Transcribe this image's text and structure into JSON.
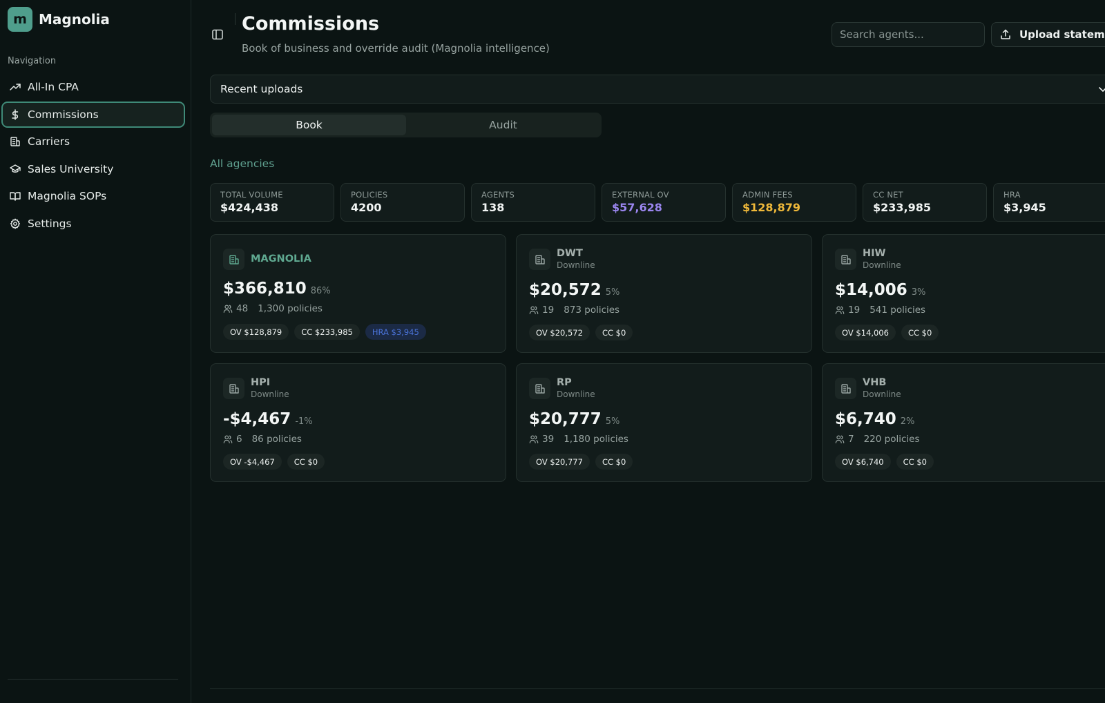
{
  "app": {
    "logo_letter": "m",
    "name": "Magnolia"
  },
  "sidebar": {
    "heading": "Navigation",
    "items": [
      {
        "label": "All-In CPA",
        "icon": "trending-up-icon",
        "active": false
      },
      {
        "label": "Commissions",
        "icon": "dollar-icon",
        "active": true
      },
      {
        "label": "Carriers",
        "icon": "building-icon",
        "active": false
      },
      {
        "label": "Sales University",
        "icon": "graduation-cap-icon",
        "active": false
      },
      {
        "label": "Magnolia SOPs",
        "icon": "book-icon",
        "active": false
      },
      {
        "label": "Settings",
        "icon": "gear-icon",
        "active": false
      }
    ]
  },
  "header": {
    "title": "Commissions",
    "subtitle": "Book of business and override audit (Magnolia intelligence)",
    "search_placeholder": "Search agents...",
    "upload_label": "Upload statement"
  },
  "recent": {
    "label": "Recent uploads"
  },
  "tabs": [
    {
      "label": "Book",
      "active": true
    },
    {
      "label": "Audit",
      "active": false
    }
  ],
  "section_label": "All agencies",
  "stats": [
    {
      "label": "TOTAL VOLUME",
      "value": "$424,438",
      "color": "#f1f4f3"
    },
    {
      "label": "POLICIES",
      "value": "4200",
      "color": "#f1f4f3"
    },
    {
      "label": "AGENTS",
      "value": "138",
      "color": "#f1f4f3"
    },
    {
      "label": "EXTERNAL OV",
      "value": "$57,628",
      "color": "#9b86f0"
    },
    {
      "label": "ADMIN FEES",
      "value": "$128,879",
      "color": "#f0b93a"
    },
    {
      "label": "CC NET",
      "value": "$233,985",
      "color": "#f1f4f3"
    },
    {
      "label": "HRA",
      "value": "$3,945",
      "color": "#f1f4f3"
    }
  ],
  "agencies": [
    {
      "name": "MAGNOLIA",
      "role": "",
      "amount": "$366,810",
      "pct": "86%",
      "agents": "48",
      "policies": "1,300 policies",
      "chips": [
        "OV $128,879",
        "CC $233,985",
        "HRA $3,945"
      ]
    },
    {
      "name": "DWT",
      "role": "Downline",
      "amount": "$20,572",
      "pct": "5%",
      "agents": "19",
      "policies": "873 policies",
      "chips": [
        "OV $20,572",
        "CC $0"
      ]
    },
    {
      "name": "HIW",
      "role": "Downline",
      "amount": "$14,006",
      "pct": "3%",
      "agents": "19",
      "policies": "541 policies",
      "chips": [
        "OV $14,006",
        "CC $0"
      ]
    },
    {
      "name": "HPI",
      "role": "Downline",
      "amount": "-$4,467",
      "pct": "-1%",
      "agents": "6",
      "policies": "86 policies",
      "chips": [
        "OV -$4,467",
        "CC $0"
      ]
    },
    {
      "name": "RP",
      "role": "Downline",
      "amount": "$20,777",
      "pct": "5%",
      "agents": "39",
      "policies": "1,180 policies",
      "chips": [
        "OV $20,777",
        "CC $0"
      ]
    },
    {
      "name": "VHB",
      "role": "Downline",
      "amount": "$6,740",
      "pct": "2%",
      "agents": "7",
      "policies": "220 policies",
      "chips": [
        "OV $6,740",
        "CC $0"
      ]
    }
  ],
  "colors": {
    "accent": "#4f9e8c",
    "background": "#0b1413",
    "card": "#121c1b",
    "hra_chip": "#4a73d8"
  }
}
